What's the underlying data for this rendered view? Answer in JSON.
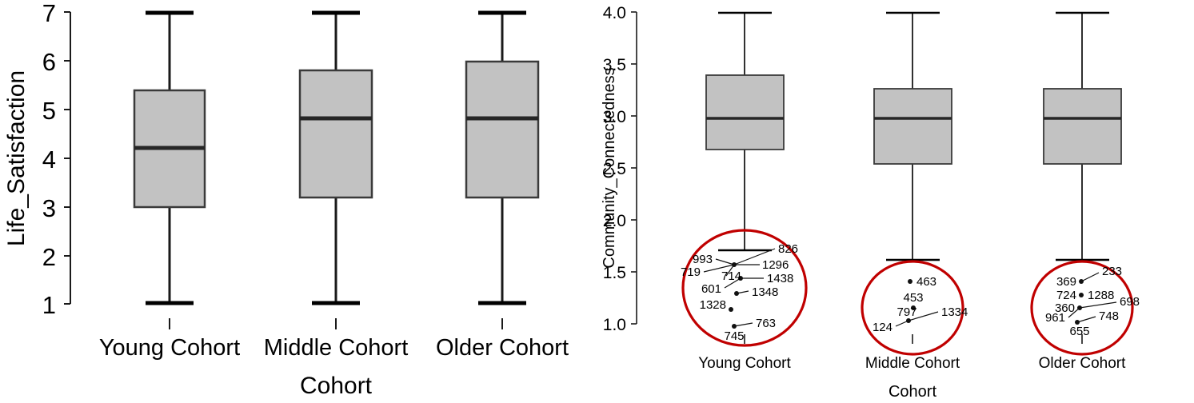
{
  "chart_data": [
    {
      "panel_id": "life-satisfaction",
      "type": "box",
      "title": "",
      "xlabel": "Cohort",
      "ylabel": "Life_Satisfaction",
      "ylim": [
        1,
        7
      ],
      "yticks": [
        "1",
        "2",
        "3",
        "4",
        "5",
        "6",
        "7"
      ],
      "ytick_values": [
        1,
        2,
        3,
        4,
        5,
        6,
        7
      ],
      "categories": [
        "Young Cohort",
        "Middle Cohort",
        "Older Cohort"
      ],
      "grid": false,
      "legend": "none",
      "boxes": [
        {
          "category": "Young Cohort",
          "whisker_low": 1.0,
          "q1": 3.0,
          "median": 4.2,
          "q3": 5.4,
          "whisker_high": 7.0,
          "outliers": []
        },
        {
          "category": "Middle Cohort",
          "whisker_low": 1.0,
          "q1": 3.2,
          "median": 4.8,
          "q3": 5.8,
          "whisker_high": 7.0,
          "outliers": []
        },
        {
          "category": "Older Cohort",
          "whisker_low": 1.0,
          "q1": 3.2,
          "median": 4.8,
          "q3": 6.0,
          "whisker_high": 7.0,
          "outliers": []
        }
      ]
    },
    {
      "panel_id": "community-connectedness",
      "type": "box",
      "title": "",
      "xlabel": "Cohort",
      "ylabel": "Community_Connectedness",
      "ylim": [
        1.0,
        4.0
      ],
      "yticks": [
        "1.0",
        "1.5",
        "2.0",
        "2.5",
        "3.0",
        "3.5",
        "4.0"
      ],
      "ytick_values": [
        1.0,
        1.5,
        2.0,
        2.5,
        3.0,
        3.5,
        4.0
      ],
      "categories": [
        "Young Cohort",
        "Middle Cohort",
        "Older Cohort"
      ],
      "grid": false,
      "legend": "none",
      "boxes": [
        {
          "category": "Young Cohort",
          "whisker_low": 1.72,
          "q1": 2.7,
          "median": 3.0,
          "q3": 3.43,
          "whisker_high": 4.0,
          "outliers": [
            {
              "label": "826",
              "value": 1.5
            },
            {
              "label": "993",
              "value": 1.5
            },
            {
              "label": "1296",
              "value": 1.5
            },
            {
              "label": "719",
              "value": 1.5
            },
            {
              "label": "714",
              "value": 1.5
            },
            {
              "label": "1438",
              "value": 1.43
            },
            {
              "label": "601",
              "value": 1.43
            },
            {
              "label": "1348",
              "value": 1.3
            },
            {
              "label": "1328",
              "value": 1.18
            },
            {
              "label": "763",
              "value": 1.03
            },
            {
              "label": "745",
              "value": 1.03
            }
          ]
        },
        {
          "category": "Middle Cohort",
          "whisker_low": 1.57,
          "q1": 2.57,
          "median": 3.0,
          "q3": 3.29,
          "whisker_high": 4.0,
          "outliers": [
            {
              "label": "463",
              "value": 1.43
            },
            {
              "label": "453",
              "value": 1.2
            },
            {
              "label": "797",
              "value": 1.08
            },
            {
              "label": "1334",
              "value": 1.08
            },
            {
              "label": "124",
              "value": 1.08
            }
          ]
        },
        {
          "category": "Older Cohort",
          "whisker_low": 1.57,
          "q1": 2.57,
          "median": 3.0,
          "q3": 3.29,
          "whisker_high": 4.0,
          "outliers": [
            {
              "label": "369",
              "value": 1.45
            },
            {
              "label": "233",
              "value": 1.45
            },
            {
              "label": "724",
              "value": 1.33
            },
            {
              "label": "1288",
              "value": 1.33
            },
            {
              "label": "360",
              "value": 1.22
            },
            {
              "label": "698",
              "value": 1.22
            },
            {
              "label": "961",
              "value": 1.22
            },
            {
              "label": "748",
              "value": 1.08
            },
            {
              "label": "655",
              "value": 1.08
            }
          ]
        }
      ],
      "highlight": {
        "shape": "ellipse",
        "color": "#c00000",
        "note": "red ellipse drawn around low outlier cluster of each cohort"
      }
    }
  ],
  "left_panel": {
    "y_axis_title": "Life_Satisfaction",
    "x_axis_title": "Cohort",
    "y_ticks": [
      "7",
      "6",
      "5",
      "4",
      "3",
      "2",
      "1"
    ],
    "categories": [
      "Young Cohort",
      "Middle Cohort",
      "Older Cohort"
    ]
  },
  "right_panel": {
    "y_axis_title": "Community_Connectedness",
    "x_axis_title": "Cohort",
    "y_ticks": [
      "4.0",
      "3.5",
      "3.0",
      "2.5",
      "2.0",
      "1.5",
      "1.0"
    ],
    "categories": [
      "Young Cohort",
      "Middle Cohort",
      "Older Cohort"
    ],
    "outlier_labels": {
      "young": [
        "826",
        "993",
        "1296",
        "719",
        "714",
        "1438",
        "601",
        "1348",
        "1328",
        "763",
        "745"
      ],
      "middle": [
        "463",
        "453",
        "797",
        "1334",
        "124"
      ],
      "older": [
        "369",
        "233",
        "724",
        "1288",
        "360",
        "698",
        "961",
        "748",
        "655"
      ]
    }
  },
  "colors": {
    "box_fill": "#c2c2c2",
    "box_stroke": "#3a3a3a",
    "highlight": "#c00000",
    "axis": "#1a1a1a",
    "text": "#000000"
  }
}
